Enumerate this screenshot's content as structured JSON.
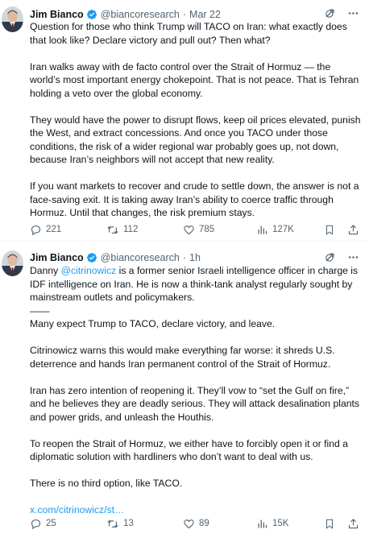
{
  "tweets": [
    {
      "author_name": "Jim Bianco",
      "handle": "@biancoresearch",
      "separator": "·",
      "time": "Mar 22",
      "paragraphs": [
        "Question for those who think Trump will TACO on Iran: what exactly does that look like? Declare victory and pull out? Then what?",
        "Iran walks away with de facto control over the Strait of Hormuz — the world’s most important energy chokepoint. That is not peace. That is Tehran holding a veto over the global economy.",
        "They would have the power to disrupt flows, keep oil prices elevated, punish the West, and extract concessions. And once you TACO under those conditions, the risk of a wider regional war probably goes up, not down, because Iran’s neighbors will not accept that new reality.",
        "If you want markets to recover and crude to settle down, the answer is not a face-saving exit. It is taking away Iran’s ability to coerce traffic through Hormuz. Until that changes, the risk premium stays."
      ],
      "stats": {
        "replies": "221",
        "reposts": "112",
        "likes": "785",
        "views": "127K"
      }
    },
    {
      "author_name": "Jim Bianco",
      "handle": "@biancoresearch",
      "separator": "·",
      "time": "1h",
      "intro_before_mention": "Danny ",
      "mention": "@citrinowicz",
      "intro_after_mention": " is a former senior Israeli intelligence officer in charge is IDF intelligence on Iran. He is now a think-tank analyst regularly sought by mainstream outlets and policymakers.",
      "rule": "——",
      "paragraphs": [
        "Many expect Trump to TACO, declare victory, and leave.",
        "Citrinowicz warns this would make everything far worse: it shreds U.S. deterrence and hands Iran permanent control of the Strait of Hormuz.",
        "Iran has zero intention of reopening it. They’ll vow to “set the Gulf on fire,” and he believes they are deadly serious. They will attack desalination plants and power grids, and unleash the Houthis.",
        "To reopen the Strait of Hormuz, we either have to forcibly open it or find a diplomatic solution with hardliners who don’t want to deal with us.",
        "There is no third option, like TACO."
      ],
      "link_text": "x.com/citrinowicz/st…",
      "stats": {
        "replies": "25",
        "reposts": "13",
        "likes": "89",
        "views": "15K"
      }
    }
  ],
  "icons": {
    "verified": "verified-badge-icon",
    "grok": "grok-icon",
    "more": "more-icon",
    "reply": "reply-icon",
    "repost": "repost-icon",
    "like": "like-icon",
    "views": "views-icon",
    "bookmark": "bookmark-icon",
    "share": "share-icon"
  },
  "colors": {
    "accent": "#1d9bf0",
    "text": "#0f1419",
    "secondary": "#536471",
    "divider": "#eff3f4"
  }
}
